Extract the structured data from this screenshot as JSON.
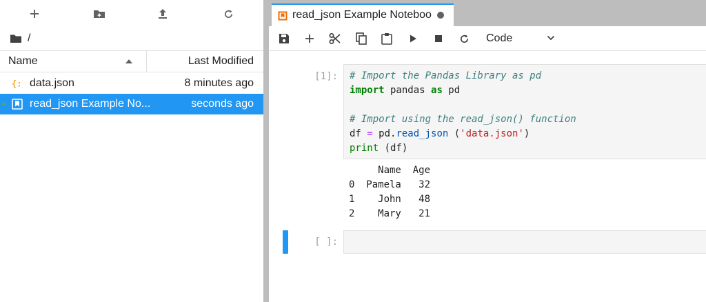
{
  "filebrowser": {
    "toolbar": [
      "new-launcher",
      "new-folder",
      "upload",
      "refresh"
    ],
    "breadcrumb": "/",
    "columns": {
      "name": "Name",
      "modified": "Last Modified"
    },
    "items": [
      {
        "name": "data.json",
        "modified": "8 minutes ago",
        "icon": "json-file-icon",
        "selected": false
      },
      {
        "name": "read_json Example No...",
        "modified": "seconds ago",
        "icon": "notebook-icon",
        "selected": true
      }
    ]
  },
  "tab": {
    "title": "read_json Example Noteboo",
    "icon": "notebook-icon"
  },
  "toolbar": {
    "cell_type": "Code"
  },
  "cells": [
    {
      "prompt": "[1]:",
      "code": {
        "line1": "# Import the Pandas Library as pd",
        "line2_kw1": "import",
        "line2_mod": " pandas ",
        "line2_kw2": "as",
        "line2_alias": " pd",
        "line4": "# Import using the read_json() function",
        "line5_var": "df ",
        "line5_eq": "=",
        "line5_obj": " pd.",
        "line5_fn": "read_json",
        "line5_open": " (",
        "line5_str": "'data.json'",
        "line5_close": ")",
        "line6_fn": "print",
        "line6_args": " (df)"
      },
      "output": [
        "     Name  Age",
        "0  Pamela   32",
        "1    John   48",
        "2    Mary   21"
      ]
    },
    {
      "prompt": "[ ]:"
    }
  ],
  "colors": {
    "accent": "#2196f3",
    "json_icon": "#f9a825",
    "notebook_icon": "#ef6c00"
  }
}
